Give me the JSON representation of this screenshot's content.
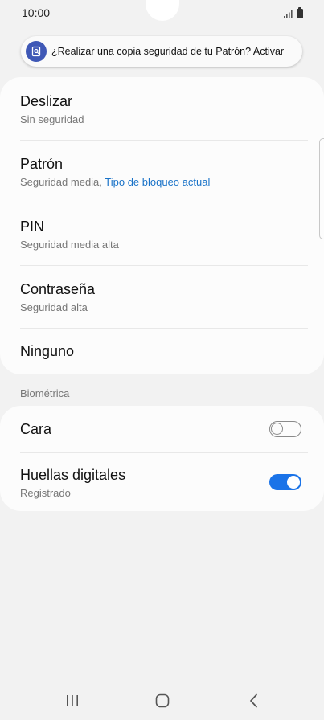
{
  "status_bar": {
    "time": "10:00"
  },
  "notification": {
    "icon": "lock-screen-backup-icon",
    "text": "¿Realizar una copia seguridad de tu Patrón?  Activar"
  },
  "lock_options": [
    {
      "title": "Deslizar",
      "subtitle": "Sin seguridad",
      "subtitle_accent": ""
    },
    {
      "title": "Patrón",
      "subtitle": "Seguridad media, ",
      "subtitle_accent": "Tipo de bloqueo actual"
    },
    {
      "title": "PIN",
      "subtitle": "Seguridad media alta",
      "subtitle_accent": ""
    },
    {
      "title": "Contraseña",
      "subtitle": "Seguridad alta",
      "subtitle_accent": ""
    },
    {
      "title": "Ninguno",
      "subtitle": "",
      "subtitle_accent": ""
    }
  ],
  "biometric": {
    "header": "Biométrica",
    "items": [
      {
        "title": "Cara",
        "subtitle": "",
        "enabled": false
      },
      {
        "title": "Huellas digitales",
        "subtitle": "Registrado",
        "enabled": true
      }
    ]
  },
  "colors": {
    "accent": "#1a73c8",
    "toggle_on": "#1a73e8",
    "notification_icon_bg": "#3f58b6",
    "background": "#f2f2f2",
    "card": "#fcfcfc"
  },
  "nav_bar": {
    "recents_icon": "recents-icon",
    "home_icon": "home-icon",
    "back_icon": "back-icon"
  }
}
